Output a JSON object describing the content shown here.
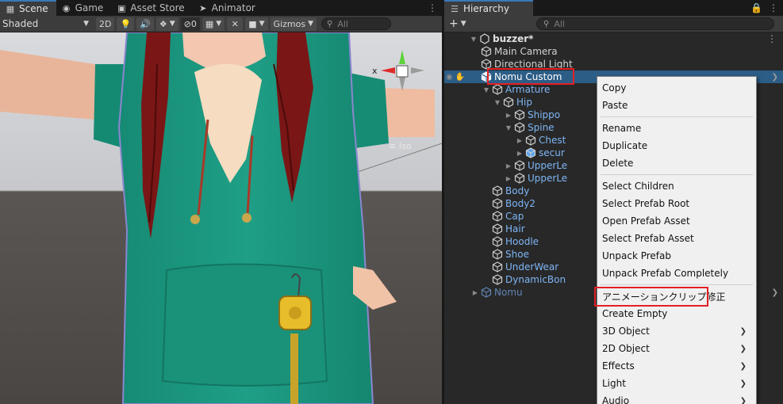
{
  "scene_panel": {
    "tabs": [
      {
        "label": "Scene",
        "icon": "grid-icon",
        "active": true
      },
      {
        "label": "Game",
        "icon": "gamepad-icon",
        "active": false
      },
      {
        "label": "Asset Store",
        "icon": "store-icon",
        "active": false
      },
      {
        "label": "Animator",
        "icon": "animator-icon",
        "active": false
      }
    ],
    "toolbar": {
      "shading_mode": "Shaded",
      "mode_2d": "2D",
      "hidden_count": "0",
      "gizmos_label": "Gizmos",
      "search_placeholder": "All"
    },
    "gizmo_axis_label": "x",
    "view_label": "≡ Iso"
  },
  "hierarchy": {
    "tab_label": "Hierarchy",
    "search_placeholder": "All",
    "add_label": "+",
    "scene_name": "buzzer*",
    "rows": [
      {
        "label": "Main Camera",
        "depth": 1,
        "arrow": "",
        "style": "normal"
      },
      {
        "label": "Directional Light",
        "depth": 1,
        "arrow": "",
        "style": "normal"
      },
      {
        "label": "Nomu Custom",
        "depth": 1,
        "arrow": "",
        "style": "selected"
      },
      {
        "label": "Armature",
        "depth": 2,
        "arrow": "open",
        "style": "prefab"
      },
      {
        "label": "Hip",
        "depth": 3,
        "arrow": "open",
        "style": "prefab"
      },
      {
        "label": "Shippo",
        "depth": 4,
        "arrow": "closed",
        "style": "prefab"
      },
      {
        "label": "Spine",
        "depth": 4,
        "arrow": "open",
        "style": "prefab"
      },
      {
        "label": "Chest",
        "depth": 5,
        "arrow": "closed",
        "style": "prefab"
      },
      {
        "label": "secur",
        "depth": 5,
        "arrow": "closed",
        "style": "prefab-mod"
      },
      {
        "label": "UpperLe",
        "depth": 4,
        "arrow": "closed",
        "style": "prefab"
      },
      {
        "label": "UpperLe",
        "depth": 4,
        "arrow": "closed",
        "style": "prefab"
      },
      {
        "label": "Body",
        "depth": 2,
        "arrow": "",
        "style": "prefab"
      },
      {
        "label": "Body2",
        "depth": 2,
        "arrow": "",
        "style": "prefab"
      },
      {
        "label": "Cap",
        "depth": 2,
        "arrow": "",
        "style": "prefab"
      },
      {
        "label": "Hair",
        "depth": 2,
        "arrow": "",
        "style": "prefab"
      },
      {
        "label": "Hoodle",
        "depth": 2,
        "arrow": "",
        "style": "prefab"
      },
      {
        "label": "Shoe",
        "depth": 2,
        "arrow": "",
        "style": "prefab"
      },
      {
        "label": "UnderWear",
        "depth": 2,
        "arrow": "",
        "style": "prefab"
      },
      {
        "label": "DynamicBon",
        "depth": 2,
        "arrow": "",
        "style": "prefab"
      },
      {
        "label": "Nomu",
        "depth": 1,
        "arrow": "closed",
        "style": "dim"
      }
    ]
  },
  "context_menu": {
    "items": [
      {
        "label": "Copy"
      },
      {
        "label": "Paste"
      },
      {
        "separator": true
      },
      {
        "label": "Rename"
      },
      {
        "label": "Duplicate"
      },
      {
        "label": "Delete"
      },
      {
        "separator": true
      },
      {
        "label": "Select Children"
      },
      {
        "label": "Select Prefab Root"
      },
      {
        "label": "Open Prefab Asset"
      },
      {
        "label": "Select Prefab Asset"
      },
      {
        "label": "Unpack Prefab"
      },
      {
        "label": "Unpack Prefab Completely"
      },
      {
        "separator": true
      },
      {
        "label": "アニメーションクリップ修正",
        "highlighted_box": true
      },
      {
        "label": "Create Empty"
      },
      {
        "label": "3D Object",
        "submenu": true
      },
      {
        "label": "2D Object",
        "submenu": true
      },
      {
        "label": "Effects",
        "submenu": true
      },
      {
        "label": "Light",
        "submenu": true
      },
      {
        "label": "Audio",
        "submenu": true
      }
    ]
  },
  "colors": {
    "selection": "#2c5d87",
    "annotation_box": "#e32024",
    "prefab_text": "#7eb6f5",
    "hoodie": "#1e9a82",
    "hair": "#7a1616"
  }
}
